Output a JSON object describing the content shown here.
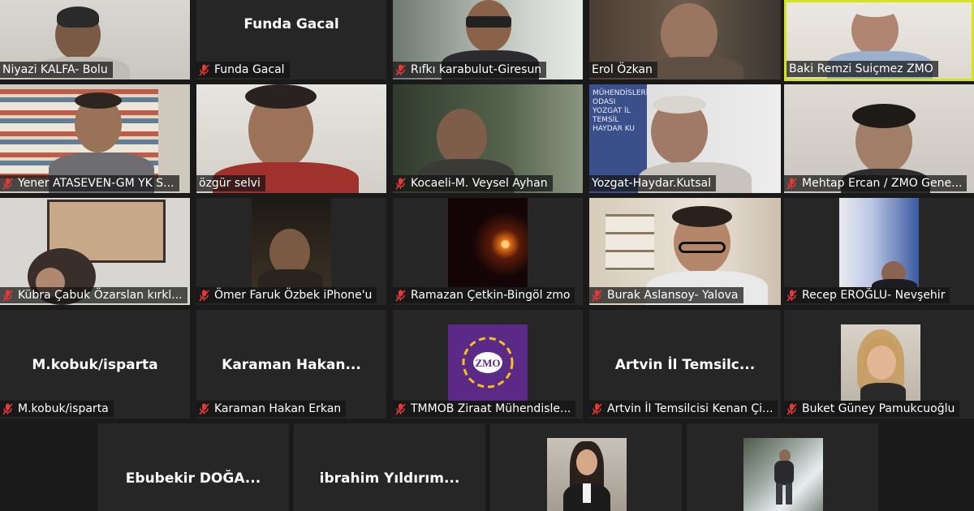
{
  "participants": [
    {
      "id": "p1",
      "name": "Niyazi KALFA- Bolu",
      "muted": false,
      "video": true
    },
    {
      "id": "p2",
      "name": "Funda Gacal",
      "muted": true,
      "video": false,
      "display_name": "Funda Gacal"
    },
    {
      "id": "p3",
      "name": "Rıfkı karabulut-Giresun",
      "muted": true,
      "video": true
    },
    {
      "id": "p4",
      "name": "Erol Özkan",
      "muted": false,
      "video": true
    },
    {
      "id": "p5",
      "name": "Baki Remzi Suiçmez ZMO",
      "muted": false,
      "video": true,
      "active_speaker": true
    },
    {
      "id": "p6",
      "name": "Yener ATASEVEN-GM YK S...",
      "muted": true,
      "video": true
    },
    {
      "id": "p7",
      "name": "özgür selvi",
      "muted": false,
      "video": true
    },
    {
      "id": "p8",
      "name": "Kocaeli-M. Veysel Ayhan",
      "muted": true,
      "video": true
    },
    {
      "id": "p9",
      "name": "Yozgat-Haydar.Kutsal",
      "muted": false,
      "video": true,
      "background_text": "MÜHENDİSLERİ ODASI YOZGAT İL TEMSİL HAYDAR KU"
    },
    {
      "id": "p10",
      "name": "Mehtap Ercan / ZMO Gene...",
      "muted": true,
      "video": true
    },
    {
      "id": "p11",
      "name": "Kübra Çabuk Özarslan kırkl...",
      "muted": true,
      "video": true
    },
    {
      "id": "p12",
      "name": "Ömer Faruk Özbek iPhone'u",
      "muted": true,
      "video": true
    },
    {
      "id": "p13",
      "name": "Ramazan Çetkin-Bingöl zmo",
      "muted": true,
      "video": true
    },
    {
      "id": "p14",
      "name": "Burak Aslansoy- Yalova",
      "muted": true,
      "video": true
    },
    {
      "id": "p15",
      "name": "Recep EROĞLU- Nevşehir",
      "muted": true,
      "video": true
    },
    {
      "id": "p16",
      "name": "M.kobuk/isparta",
      "muted": true,
      "video": false,
      "display_name": "M.kobuk/isparta"
    },
    {
      "id": "p17",
      "name": "Karaman Hakan Erkan",
      "muted": true,
      "video": false,
      "display_name": "Karaman  Hakan..."
    },
    {
      "id": "p18",
      "name": "TMMOB Ziraat Mühendisle...",
      "muted": true,
      "video": false,
      "avatar_text": "ZMO"
    },
    {
      "id": "p19",
      "name": "Artvin İl Temsilcisi Kenan Çi...",
      "muted": true,
      "video": false,
      "display_name": "Artvin  İl  Temsilc..."
    },
    {
      "id": "p20",
      "name": "Buket Güney Pamukcuoğlu",
      "muted": true,
      "video": false,
      "has_photo": true
    },
    {
      "id": "p21",
      "name": "",
      "muted": false,
      "video": false,
      "display_name": "Ebubekir  DOĞA..."
    },
    {
      "id": "p22",
      "name": "",
      "muted": false,
      "video": false,
      "display_name": "ibrahim  Yıldırım..."
    },
    {
      "id": "p23",
      "name": "",
      "muted": false,
      "video": false,
      "has_photo": true
    },
    {
      "id": "p24",
      "name": "",
      "muted": false,
      "video": false,
      "has_photo": true
    }
  ],
  "colors": {
    "background": "#1a1a1a",
    "tile": "#262626",
    "active_border": "#d6e31f",
    "muted_icon": "#e53935",
    "zmo_purple": "#5b2a86",
    "zmo_yellow": "#f2c21b"
  }
}
